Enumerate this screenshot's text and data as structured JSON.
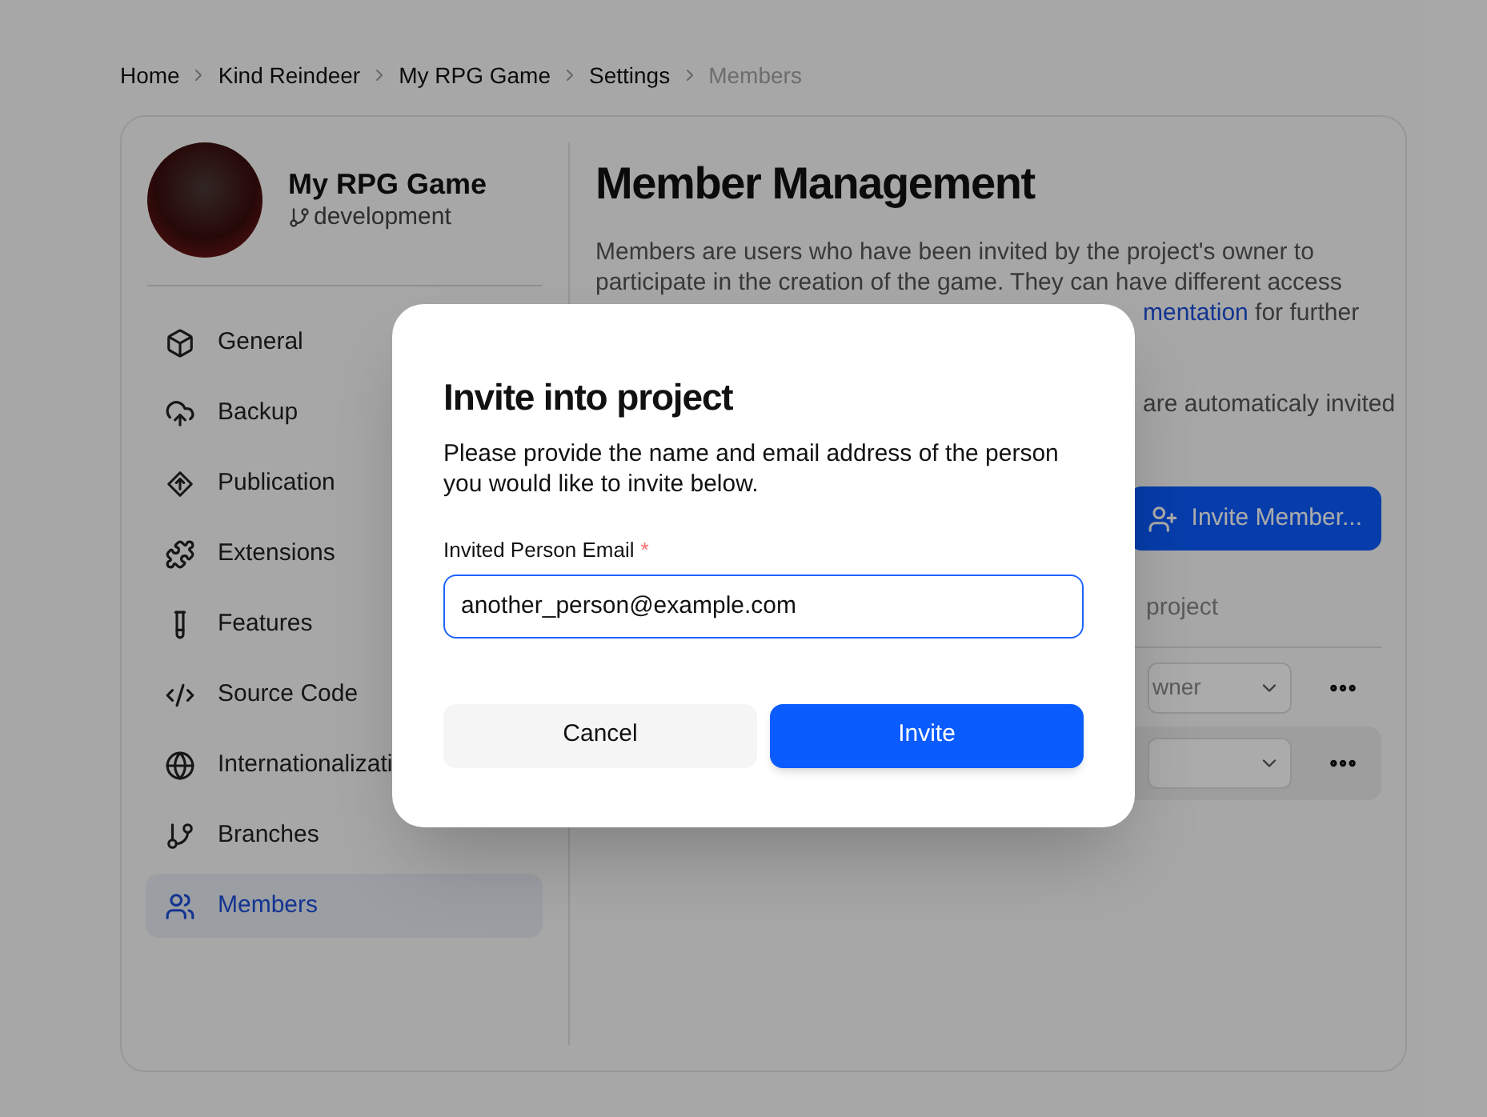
{
  "breadcrumb": [
    {
      "label": "Home",
      "current": false
    },
    {
      "label": "Kind Reindeer",
      "current": false
    },
    {
      "label": "My RPG Game",
      "current": false
    },
    {
      "label": "Settings",
      "current": false
    },
    {
      "label": "Members",
      "current": true
    }
  ],
  "sidebar": {
    "project_name": "My RPG Game",
    "branch": "development",
    "items": [
      {
        "label": "General",
        "selected": false
      },
      {
        "label": "Backup",
        "selected": false
      },
      {
        "label": "Publication",
        "selected": false
      },
      {
        "label": "Extensions",
        "selected": false
      },
      {
        "label": "Features",
        "selected": false
      },
      {
        "label": "Source Code",
        "selected": false
      },
      {
        "label": "Internationalizati",
        "selected": false
      },
      {
        "label": "Branches",
        "selected": false
      },
      {
        "label": "Members",
        "selected": true
      }
    ]
  },
  "main": {
    "title": "Member Management",
    "description_lines": [
      "Members are users who have been invited by the project's owner to",
      "participate in the creation of the game. They can have different access"
    ],
    "description_fragments": [
      [
        {
          "text": "mentation",
          "link": true
        },
        {
          "text": " for further",
          "link": false
        }
      ],
      [
        {
          "text": "are automaticaly invited",
          "link": false
        }
      ]
    ],
    "invite_button": "Invite Member...",
    "list_heading": "project",
    "member_rows": [
      {
        "role": "wner",
        "highlighted": false
      },
      {
        "highlighted": true
      }
    ]
  },
  "dialog": {
    "title": "Invite into project",
    "description": "Please provide the name and email address of the person you would like to invite below.",
    "field": {
      "label": "Invited Person Email",
      "required_mark": "*",
      "value": "another_person@example.com"
    },
    "buttons": [
      {
        "label": "Cancel",
        "kind": "secondary"
      },
      {
        "label": "Invite",
        "kind": "primary"
      }
    ]
  }
}
